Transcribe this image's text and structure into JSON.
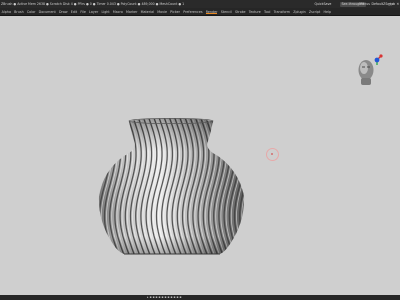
{
  "titlebar": {
    "status": "ZBrush ● Active Mem 2638 ● Scratch Disk 4 ● PFirs ● 0 ● Timer 0.043 ● PolyCount ● 489,000 ● MeshCount ● 1",
    "quicksave": "QuickSave",
    "see_through": "See-through 0",
    "menus": "Menus",
    "default_btn": "DefaultZScript",
    "window_icons": "◻ ▭ ✕"
  },
  "menubar": {
    "items": [
      "Alpha",
      "Brush",
      "Color",
      "Document",
      "Draw",
      "Edit",
      "File",
      "Layer",
      "Light",
      "Macro",
      "Marker",
      "Material",
      "Movie",
      "Picker",
      "Preferences",
      "Render",
      "Stencil",
      "Stroke",
      "Texture",
      "Tool",
      "Transform",
      "Zplugin",
      "Zscript",
      "Help"
    ]
  },
  "bottombar": {
    "label": "▸ ▪ ▪ ▪ ▪ ▪ ▪ ▪ ▪ ▪ ▪ ▪"
  },
  "colors": {
    "accent": "#e8861f",
    "viewport_bg": "#cfcfcf",
    "chrome_bg": "#262626"
  }
}
